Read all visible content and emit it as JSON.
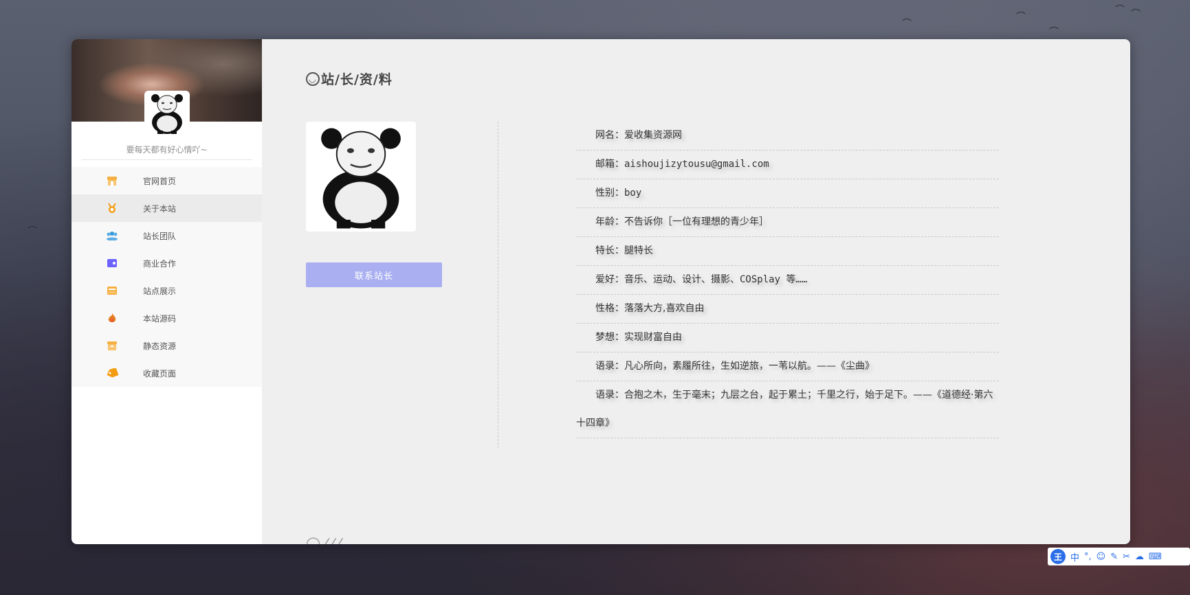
{
  "sidebar": {
    "motto": "要每天都有好心情吖~",
    "items": [
      {
        "label": "官网首页",
        "icon": "store-icon",
        "color": "#f5b041"
      },
      {
        "label": "关于本站",
        "icon": "medal-icon",
        "color": "#f39c12"
      },
      {
        "label": "站长团队",
        "icon": "team-icon",
        "color": "#5dade2"
      },
      {
        "label": "商业合作",
        "icon": "wallet-icon",
        "color": "#6c63ff"
      },
      {
        "label": "站点展示",
        "icon": "folder-icon",
        "color": "#f5b041"
      },
      {
        "label": "本站源码",
        "icon": "flame-icon",
        "color": "#e67e22"
      },
      {
        "label": "静态资源",
        "icon": "box-icon",
        "color": "#f5b041"
      },
      {
        "label": "收藏页面",
        "icon": "tag-icon",
        "color": "#f39c12"
      }
    ]
  },
  "main": {
    "title": "站/长/资/料",
    "contact_button": "联系站长",
    "info": [
      {
        "key": "网名：",
        "value": "爱收集资源网"
      },
      {
        "key": "邮箱：",
        "value": "aishoujizytousu@gmail.com"
      },
      {
        "key": "性别：",
        "value": "boy"
      },
      {
        "key": "年龄：",
        "value": "不告诉你［一位有理想的青少年］"
      },
      {
        "key": "特长：",
        "value": "腿特长"
      },
      {
        "key": "爱好：",
        "value": "音乐、运动、设计、摄影、COSplay 等……"
      },
      {
        "key": "性格：",
        "value": "落落大方,喜欢自由"
      },
      {
        "key": "梦想：",
        "value": "实现财富自由"
      },
      {
        "key": "语录：",
        "value": "凡心所向，素履所往，生如逆旅，一苇以航。——《尘曲》"
      },
      {
        "key": "语录：",
        "value": "合抱之木，生于毫末；九层之台，起于累土；千里之行，始于足下。——《道德经·第六十四章》"
      }
    ]
  },
  "ime": {
    "logo": "王",
    "mode": "中"
  }
}
